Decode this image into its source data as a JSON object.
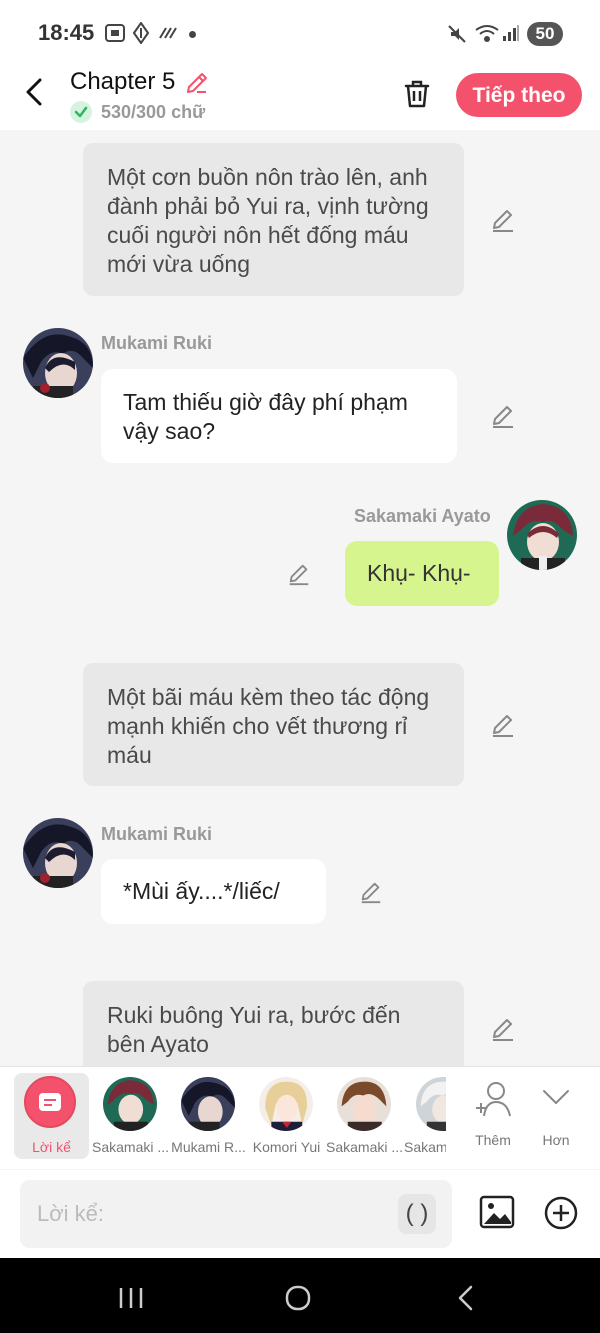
{
  "status_bar": {
    "time": "18:45",
    "battery": "50"
  },
  "header": {
    "title": "Chapter 5",
    "word_count": "530/300 chữ",
    "next_label": "Tiếp theo"
  },
  "messages": [
    {
      "kind": "narration",
      "text": "Một cơn buồn nôn trào lên, anh đành phải bỏ Yui ra, vịnh tường cuối người nôn hết đống máu mới vừa uống"
    },
    {
      "kind": "left",
      "sender": "Mukami Ruki",
      "text": "Tam thiếu giờ đây phí phạm vậy sao?"
    },
    {
      "kind": "right",
      "sender": "Sakamaki Ayato",
      "text": "Khụ- Khụ-"
    },
    {
      "kind": "narration",
      "text": "Một bãi máu kèm theo tác động mạnh khiến cho vết thương rỉ máu"
    },
    {
      "kind": "left",
      "sender": "Mukami Ruki",
      "text": "*Mùi ấy....*/liếc/"
    },
    {
      "kind": "narration",
      "text": "Ruki buông Yui ra, bước đến bên Ayato"
    }
  ],
  "characters": [
    {
      "label": "Lời kể",
      "selected": true
    },
    {
      "label": "Sakamaki ..."
    },
    {
      "label": "Mukami R..."
    },
    {
      "label": "Komori Yui"
    },
    {
      "label": "Sakamaki ..."
    },
    {
      "label": "Sakam"
    }
  ],
  "char_actions": {
    "more_label": "Thêm",
    "less_label": "Hơn"
  },
  "composer": {
    "placeholder": "Lời kể:",
    "paren_label": "( )"
  },
  "colors": {
    "accent": "#f4526c",
    "green_bubble": "#d7f58e",
    "narration_bg": "#e8e8e8"
  }
}
